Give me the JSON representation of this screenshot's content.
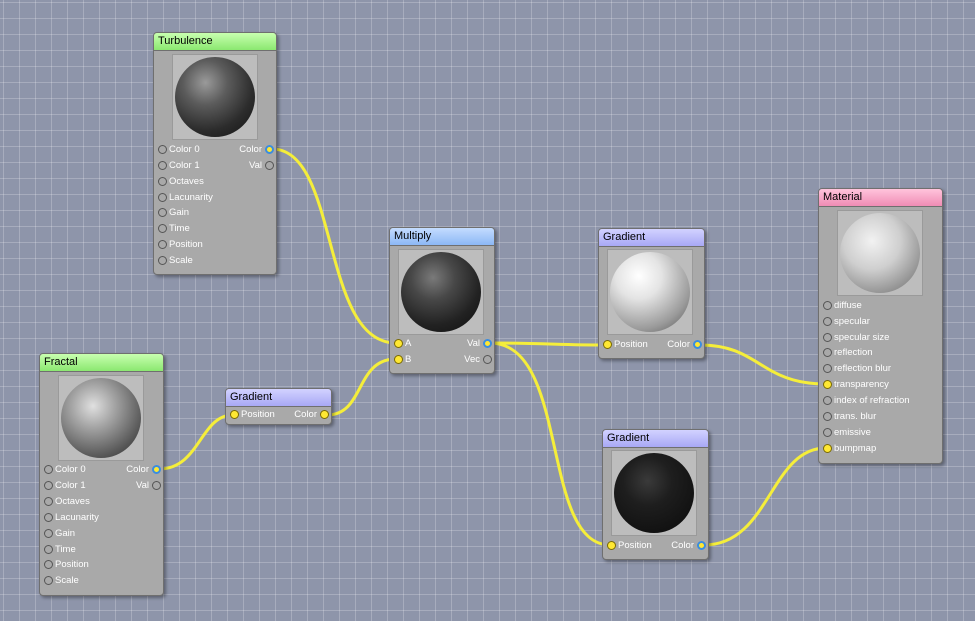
{
  "nodes": {
    "turbulence": {
      "title": "Turbulence",
      "inputs": [
        "Color 0",
        "Color 1",
        "Octaves",
        "Lacunarity",
        "Gain",
        "Time",
        "Position",
        "Scale"
      ],
      "outputs": [
        "Color",
        "Val"
      ]
    },
    "fractal": {
      "title": "Fractal",
      "inputs": [
        "Color 0",
        "Color 1",
        "Octaves",
        "Lacunarity",
        "Gain",
        "Time",
        "Position",
        "Scale"
      ],
      "outputs": [
        "Color",
        "Val"
      ]
    },
    "gradient_small": {
      "title": "Gradient",
      "input": "Position",
      "output": "Color"
    },
    "multiply": {
      "title": "Multiply",
      "inputs": [
        "A",
        "B"
      ],
      "outputs": [
        "Val",
        "Vec"
      ]
    },
    "gradient_top": {
      "title": "Gradient",
      "input": "Position",
      "output": "Color"
    },
    "gradient_bottom": {
      "title": "Gradient",
      "input": "Position",
      "output": "Color"
    },
    "material": {
      "title": "Material",
      "inputs": [
        "diffuse",
        "specular",
        "specular size",
        "reflection",
        "reflection blur",
        "transparency",
        "index of refraction",
        "trans. blur",
        "emissive",
        "bumpmap"
      ]
    }
  },
  "colors": {
    "wire": "#f5ee3a",
    "background": "#8e95aa",
    "header_generator": "#8be870",
    "header_math": "#8cb8f5",
    "header_gradient": "#a8a8f5",
    "header_material": "#f08cb4"
  }
}
